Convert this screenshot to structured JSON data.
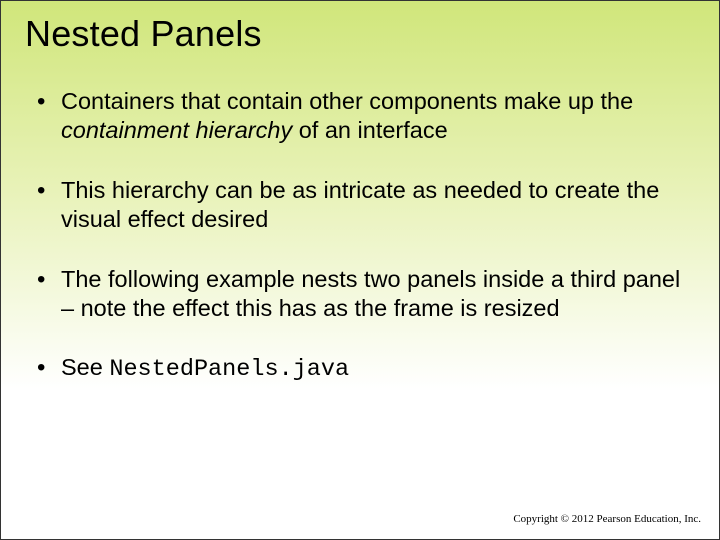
{
  "title": "Nested Panels",
  "bullets": {
    "b1a": "Containers that contain other components make up the ",
    "b1b": "containment hierarchy",
    "b1c": " of an interface",
    "b2": "This hierarchy can be as intricate as needed to create the visual effect desired",
    "b3": "The following example nests two panels inside a third panel – note the effect this has as the frame is resized",
    "b4a": "See ",
    "b4b": "NestedPanels.java"
  },
  "footer": "Copyright © 2012 Pearson Education, Inc."
}
